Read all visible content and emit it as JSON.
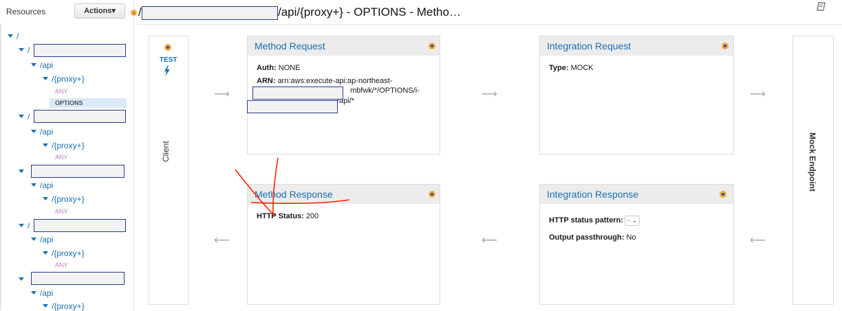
{
  "sidebar": {
    "resources_label": "Resources",
    "actions_label": "Actions",
    "actions_caret": "▾",
    "tree": {
      "root": "/",
      "slash": "/",
      "api": "/api",
      "proxy": "/{proxy+}",
      "any": "ANY",
      "options": "OPTIONS"
    }
  },
  "header": {
    "title_suffix": "/api/{proxy+} - OPTIONS - Metho…",
    "slash": "/",
    "book_icon": "book-icon"
  },
  "client": {
    "test_label": "TEST",
    "bolt": "ϟ",
    "label": "Client"
  },
  "method_request": {
    "title": "Method Request",
    "auth_key": "Auth:",
    "auth_val": "NONE",
    "arn_key": "ARN:",
    "arn_line1": "arn:aws:execute-api:ap-northeast-",
    "arn_line2": "mbfwk/*/OPTIONS/i-",
    "arn_line3": "/api/*"
  },
  "integration_request": {
    "title": "Integration Request",
    "type_key": "Type:",
    "type_val": "MOCK"
  },
  "method_response": {
    "title": "Method Response",
    "status_key": "HTTP Status:",
    "status_val": "200"
  },
  "integration_response": {
    "title": "Integration Response",
    "pattern_key": "HTTP status pattern:",
    "pattern_val": "- ⌄",
    "passthrough_key": "Output passthrough:",
    "passthrough_val": "No"
  },
  "mock": {
    "label": "Mock Endpoint"
  },
  "arrows": {
    "right": "⟶",
    "left": "⟵"
  },
  "colors": {
    "accent": "#1b6fb3",
    "orange": "#f4a83a",
    "header_bg": "#ececec",
    "annotation": "#ff2200"
  }
}
